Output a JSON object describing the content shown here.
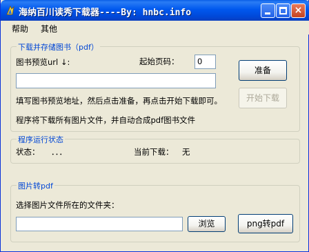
{
  "window": {
    "title": "海纳百川读秀下载器----By: hnbc.info",
    "buttons": {
      "minimize": "minimize",
      "maximize": "maximize",
      "close": "×"
    }
  },
  "menu": {
    "items": [
      "帮助",
      "其他"
    ]
  },
  "download_group": {
    "title": "下载并存储图书（pdf）",
    "preview_url_label": "图书预览url ↓:",
    "start_page_label": "起始页码：",
    "start_page_value": "0",
    "url_value": "",
    "prepare_button": "准备",
    "start_download_button": "开始下载",
    "hint_line1": "填写图书预览地址，然后点击准备，再点击开始下载即可。",
    "hint_line2": "程序将下载所有图片文件，并自动合成pdf图书文件"
  },
  "status_group": {
    "title": "程序运行状态",
    "status_label": "状态：",
    "status_value": "．．．",
    "current_download_label": "当前下载：",
    "current_download_value": "无"
  },
  "convert_group": {
    "title": "图片转pdf",
    "folder_label": "选择图片文件所在的文件夹：",
    "folder_value": "",
    "browse_button": "浏览",
    "convert_button": "png转pdf"
  }
}
